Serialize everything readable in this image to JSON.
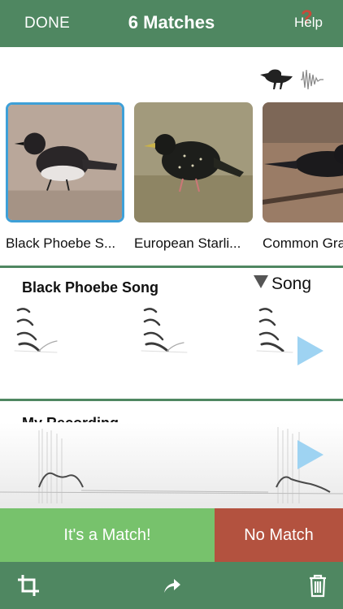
{
  "header": {
    "done_label": "DONE",
    "title": "6 Matches",
    "help_label": "Help"
  },
  "mode_icons": [
    "bird-silhouette-icon",
    "sound-wave-icon"
  ],
  "matches": [
    {
      "label": "Black Phoebe S...",
      "selected": true
    },
    {
      "label": "European Starli...",
      "selected": false
    },
    {
      "label": "Common Gra",
      "selected": false
    }
  ],
  "reference": {
    "title": "Black Phoebe Song",
    "type_selector": "Song"
  },
  "recording": {
    "title": "My Recording"
  },
  "actions": {
    "match_label": "It's a Match!",
    "no_match_label": "No Match"
  },
  "toolbar": [
    "crop-icon",
    "share-icon",
    "trash-icon"
  ],
  "colors": {
    "brand_green": "#4f8761",
    "match_green": "#77c26c",
    "no_match_red": "#b3523f",
    "selected_blue": "#3ea0d8",
    "play_blue": "#9ed3f2"
  }
}
